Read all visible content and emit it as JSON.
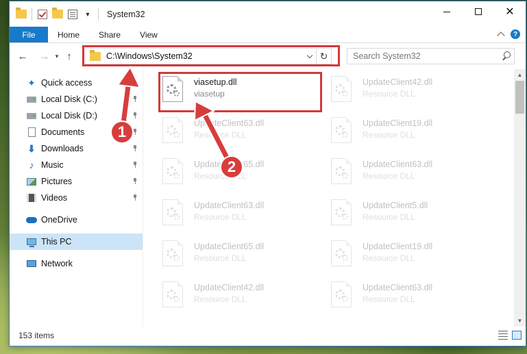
{
  "window": {
    "title": "System32",
    "controls": {
      "minimize": "—",
      "maximize": "☐",
      "close": "✕"
    }
  },
  "ribbon": {
    "tabs": [
      {
        "label": "File",
        "active": true
      },
      {
        "label": "Home"
      },
      {
        "label": "Share"
      },
      {
        "label": "View"
      }
    ],
    "help": "?"
  },
  "address": {
    "path": "C:\\Windows\\System32",
    "refresh": "↻"
  },
  "search": {
    "placeholder": "Search System32"
  },
  "nav_buttons": {
    "back": "←",
    "forward": "→",
    "recent": "▾",
    "up": "↑"
  },
  "sidebar": {
    "items": [
      {
        "label": "Quick access",
        "icon": "star-icon",
        "pinned": false
      },
      {
        "label": "Local Disk (C:)",
        "icon": "disk-icon",
        "pinned": true
      },
      {
        "label": "Local Disk (D:)",
        "icon": "disk-icon",
        "pinned": true
      },
      {
        "label": "Documents",
        "icon": "document-icon",
        "pinned": true
      },
      {
        "label": "Downloads",
        "icon": "download-icon",
        "pinned": true
      },
      {
        "label": "Music",
        "icon": "music-icon",
        "pinned": true
      },
      {
        "label": "Pictures",
        "icon": "pictures-icon",
        "pinned": true
      },
      {
        "label": "Videos",
        "icon": "video-icon",
        "pinned": true
      },
      {
        "label": "OneDrive",
        "icon": "cloud-icon",
        "pinned": false
      },
      {
        "label": "This PC",
        "icon": "computer-icon",
        "pinned": false,
        "selected": true
      },
      {
        "label": "Network",
        "icon": "network-icon",
        "pinned": false
      }
    ]
  },
  "files": [
    {
      "name": "viasetup.dll",
      "desc": "viasetup",
      "highlighted": true
    },
    {
      "name": "UpdateClient42.dll",
      "desc": "Resource DLL"
    },
    {
      "name": "UpdateClient63.dll",
      "desc": "Resource DLL"
    },
    {
      "name": "UpdateClient19.dll",
      "desc": "Resource DLL"
    },
    {
      "name": "UpdateClient65.dll",
      "desc": "Resource DLL"
    },
    {
      "name": "UpdateClient63.dll",
      "desc": "Resource DLL"
    },
    {
      "name": "UpdateClient63.dll",
      "desc": "Resource DLL"
    },
    {
      "name": "UpdateClient5.dll",
      "desc": "Resource DLL"
    },
    {
      "name": "UpdateClient65.dll",
      "desc": "Resource DLL"
    },
    {
      "name": "UpdateClient19.dll",
      "desc": "Resource DLL"
    },
    {
      "name": "UpdateClient42.dll",
      "desc": "Resource DLL"
    },
    {
      "name": "UpdateClient63.dll",
      "desc": "Resource DLL"
    }
  ],
  "status": {
    "item_count": "153 items"
  },
  "annotations": {
    "step1": "1",
    "step2": "2",
    "color": "#d83d3d"
  },
  "colors": {
    "accent": "#1979ca",
    "selection": "#cce4f7"
  }
}
